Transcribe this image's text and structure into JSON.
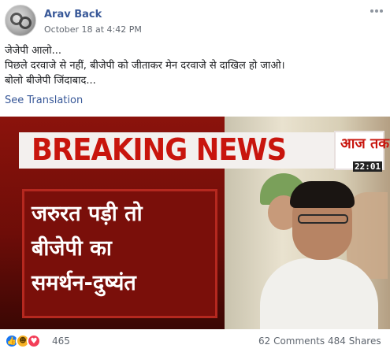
{
  "post": {
    "author": "Arav Back",
    "timestamp": "October 18 at 4:42 PM",
    "more_icon": "ellipsis-icon",
    "text_lines": [
      "जेजेपी आलो...",
      "पिछले दरवाजे से नहीं, बीजेपी को जीताकर मेन दरवाजे से दाखिल हो जाओ।",
      "बोलो बीजेपी जिंदाबाद..."
    ],
    "see_translation": "See Translation"
  },
  "image": {
    "banner": "BREAKING NEWS",
    "channel_logo": "आज तक",
    "clock": "22:01",
    "headline_lines": [
      "जरुरत पड़ी तो",
      "बीजेपी का",
      "समर्थन-दुष्यंत"
    ],
    "colors": {
      "banner_red": "#c8150d",
      "panel_red": "#7a0f0a"
    }
  },
  "footer": {
    "reaction_icons": [
      "like-icon",
      "haha-icon",
      "love-icon"
    ],
    "reaction_count": "465",
    "comments": "62 Comments",
    "shares": "484 Shares"
  },
  "colors": {
    "link": "#385898",
    "muted": "#616770"
  }
}
